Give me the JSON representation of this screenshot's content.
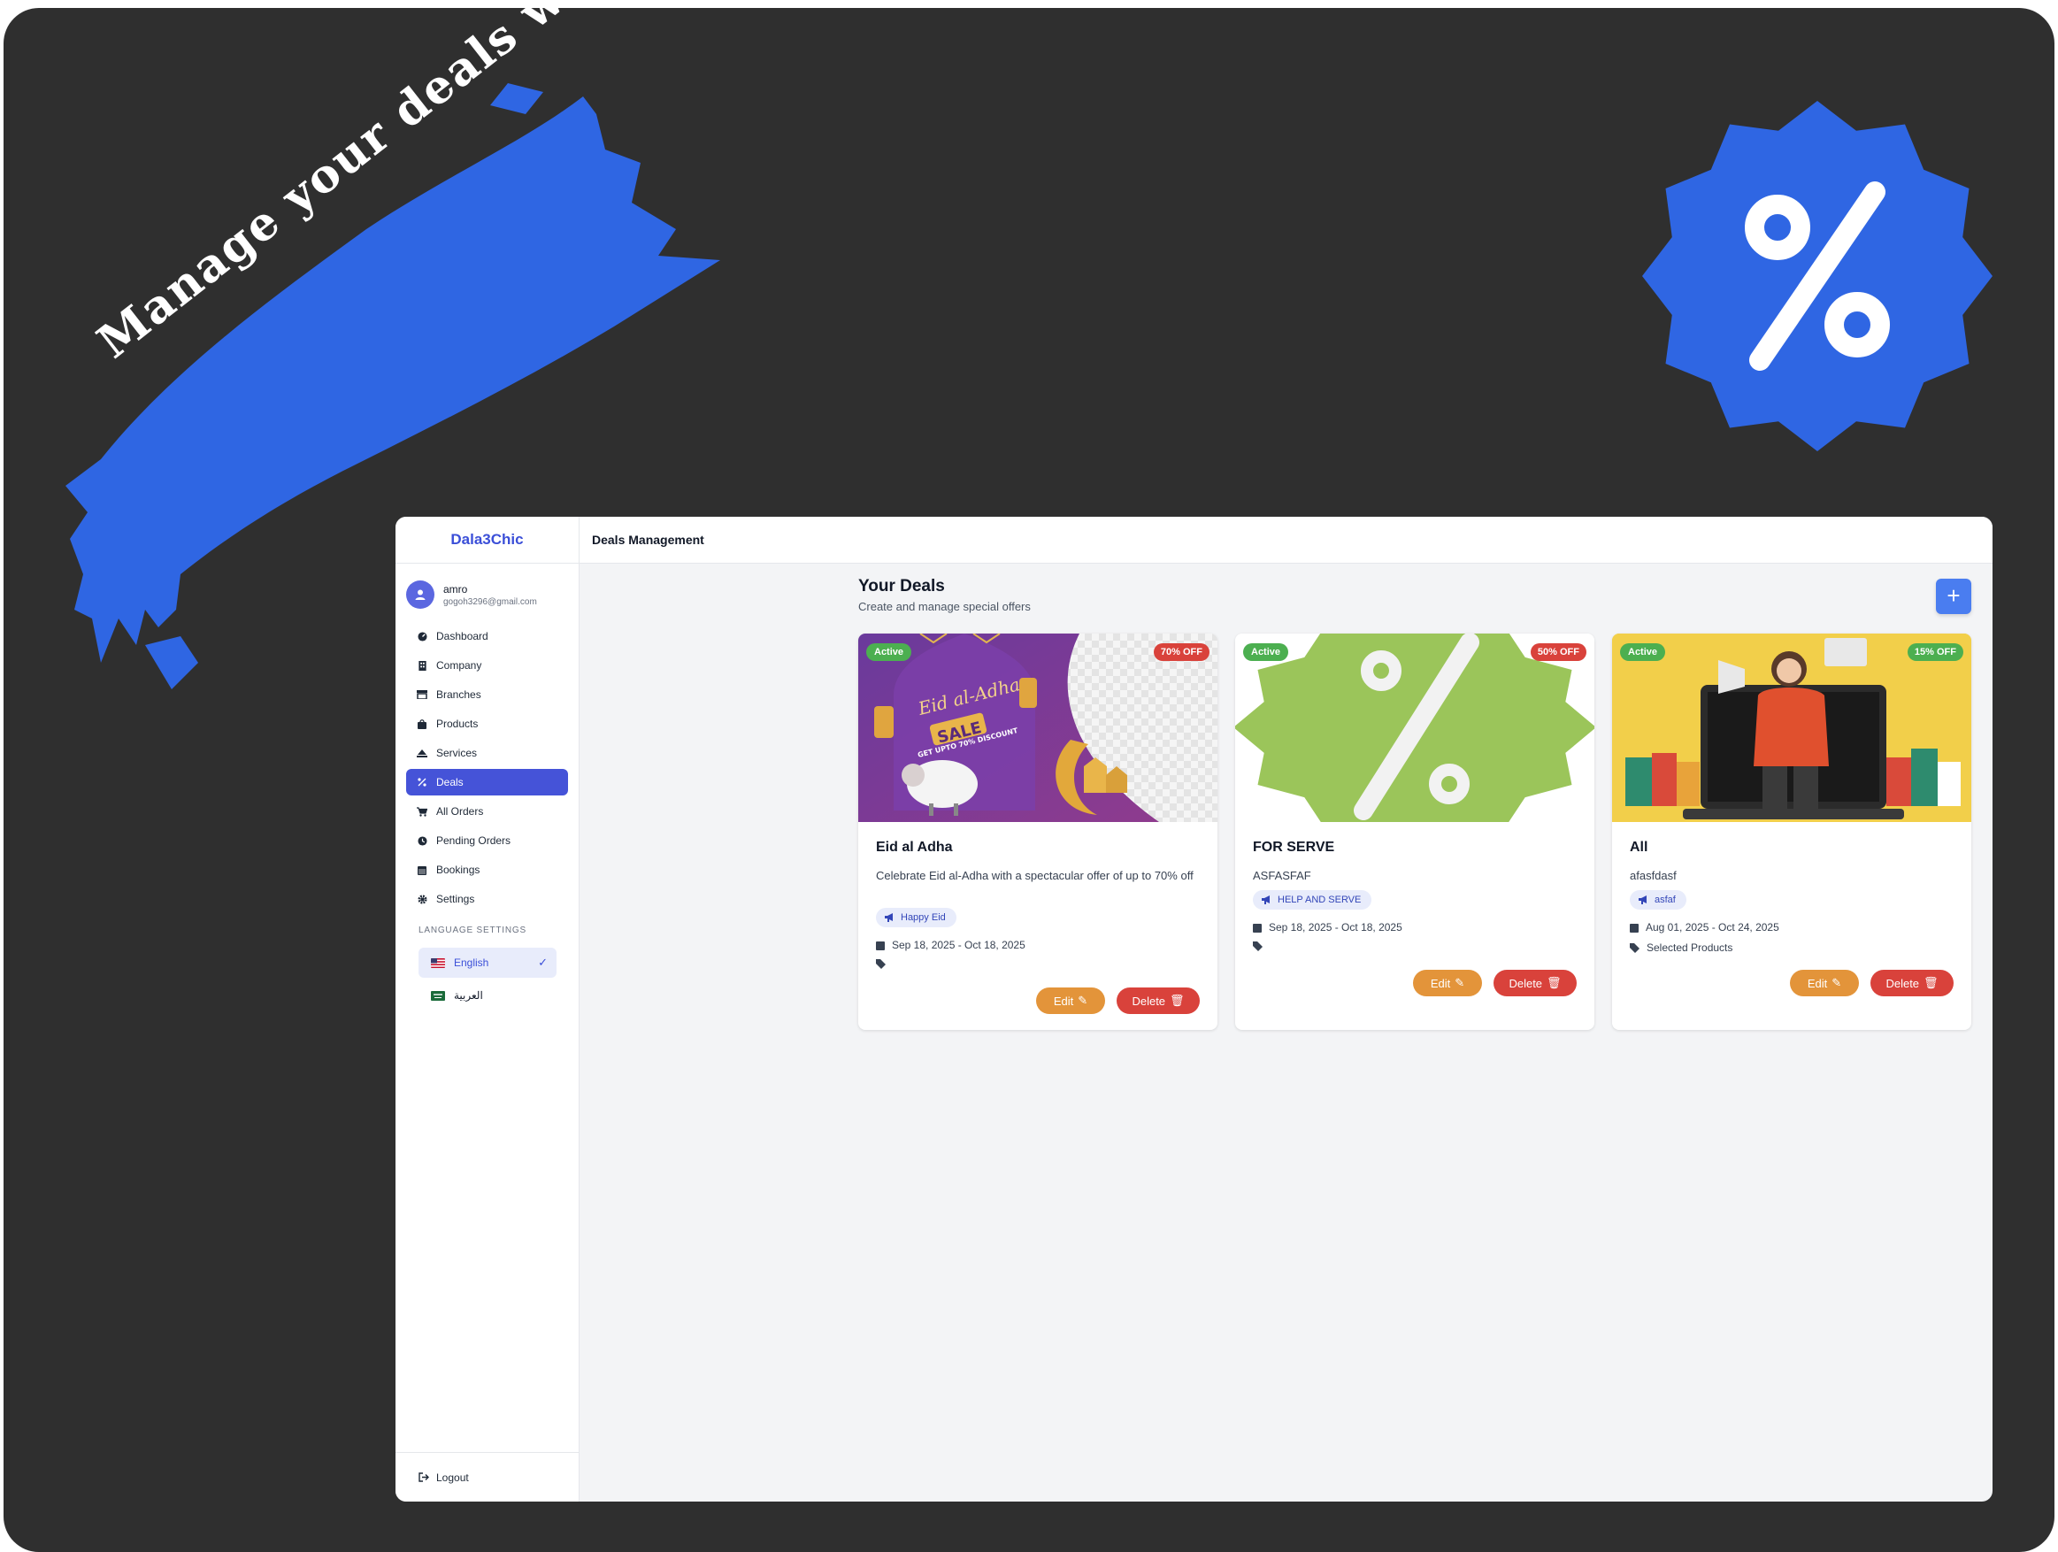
{
  "hero": {
    "headline": "Manage your deals with ease",
    "brush_color": "#2f66e3",
    "badge_color": "#2f66e3"
  },
  "app": {
    "brand": "Dala3Chic",
    "topbar_title": "Deals Management",
    "accent": "#4553d8",
    "user": {
      "name": "amro",
      "email": "gogoh3296@gmail.com"
    },
    "nav": [
      {
        "label": "Dashboard",
        "icon": "dashboard-icon"
      },
      {
        "label": "Company",
        "icon": "building-icon"
      },
      {
        "label": "Branches",
        "icon": "store-icon"
      },
      {
        "label": "Products",
        "icon": "bag-icon"
      },
      {
        "label": "Services",
        "icon": "service-icon"
      },
      {
        "label": "Deals",
        "icon": "percent-icon",
        "active": true
      },
      {
        "label": "All Orders",
        "icon": "cart-icon"
      },
      {
        "label": "Pending Orders",
        "icon": "clock-icon"
      },
      {
        "label": "Bookings",
        "icon": "calendar-icon"
      },
      {
        "label": "Settings",
        "icon": "gear-icon"
      }
    ],
    "language": {
      "title": "LANGUAGE SETTINGS",
      "options": [
        {
          "label": "English",
          "selected": true
        },
        {
          "label": "العربية",
          "selected": false
        }
      ]
    },
    "logout": "Logout",
    "page": {
      "title": "Your Deals",
      "subtitle": "Create and manage special offers",
      "add_label": "+"
    },
    "deals": [
      {
        "status": "Active",
        "discount": "70% OFF",
        "discount_color": "#d9423b",
        "title": "Eid al Adha",
        "description": "Celebrate Eid al-Adha with a spectacular offer of up to 70% off",
        "tag": "Happy Eid",
        "dates": "Sep 18, 2025 - Oct 18, 2025",
        "extra": "",
        "edit": "Edit",
        "delete": "Delete",
        "image": {
          "eid_title": "Eid al-Adha",
          "sale": "SALE",
          "sub": "GET UPTO 70% DISCOUNT"
        }
      },
      {
        "status": "Active",
        "discount": "50% OFF",
        "discount_color": "#d9423b",
        "title": "FOR SERVE",
        "description": "ASFASFAF",
        "tag": "HELP AND SERVE",
        "dates": "Sep 18, 2025 - Oct 18, 2025",
        "extra": "",
        "edit": "Edit",
        "delete": "Delete"
      },
      {
        "status": "Active",
        "discount": "15% OFF",
        "discount_color": "#4caf50",
        "title": "All",
        "description": "afasfdasf",
        "tag": "asfaf",
        "dates": "Aug 01, 2025 - Oct 24, 2025",
        "extra": "Selected Products",
        "edit": "Edit",
        "delete": "Delete"
      }
    ]
  }
}
